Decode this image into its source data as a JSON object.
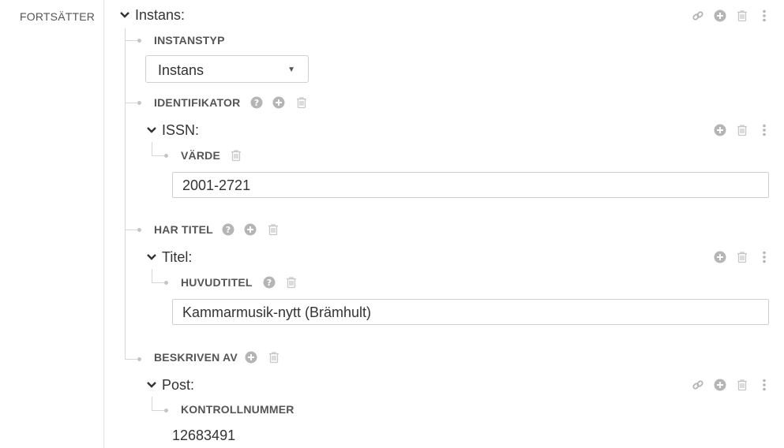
{
  "left_label": "FORTSÄTTER",
  "root": {
    "title": "Instans:"
  },
  "instanstyp": {
    "label": "INSTANSTYP",
    "selected": "Instans"
  },
  "identifikator": {
    "label": "IDENTIFIKATOR",
    "child_title": "ISSN:",
    "field_label": "VÄRDE",
    "field_value": "2001-2721"
  },
  "har_titel": {
    "label": "HAR TITEL",
    "child_title": "Titel:",
    "field_label": "HUVUDTITEL",
    "field_value": "Kammarmusik-nytt (Brämhult)"
  },
  "beskriven_av": {
    "label": "BESKRIVEN AV",
    "child_title": "Post:",
    "field_label": "KONTROLLNUMMER",
    "field_value": "12683491"
  },
  "icons": {
    "link": "link-icon",
    "add": "plus-circle-icon",
    "delete": "trash-icon",
    "menu": "vertical-dots-icon",
    "help": "question-circle-icon",
    "chevron": "chevron-down-icon"
  },
  "colors": {
    "icon_gray": "#b5b5b5",
    "line_gray": "#d7d7d7",
    "text": "#333333"
  }
}
